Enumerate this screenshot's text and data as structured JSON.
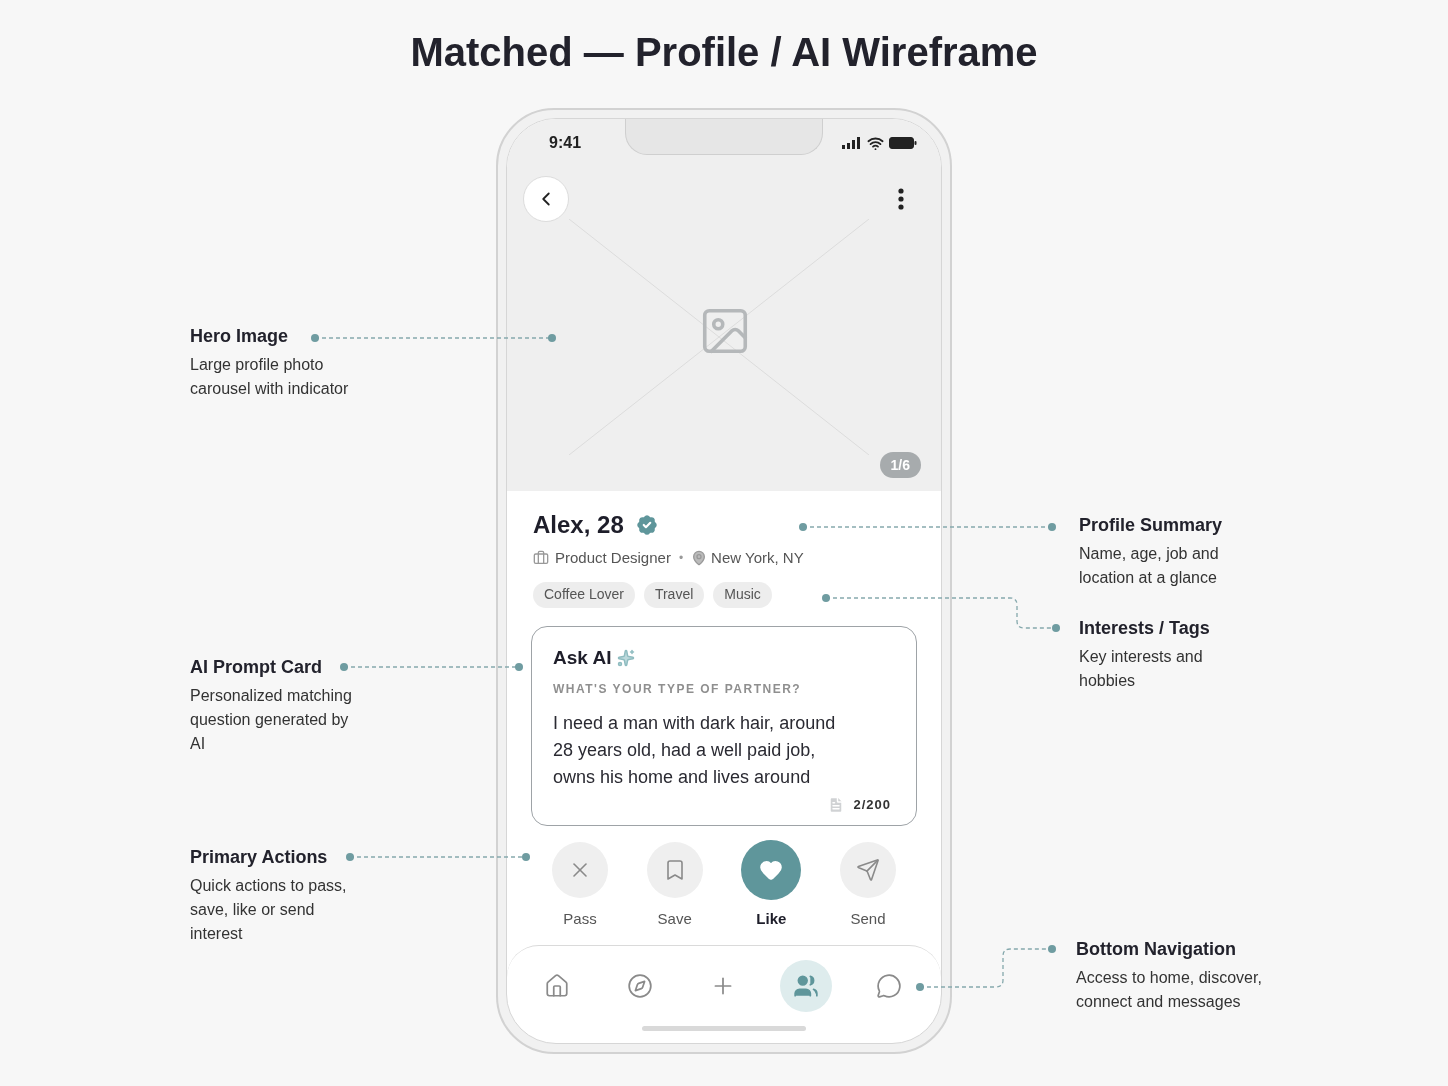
{
  "title": "Matched — Profile / AI Wireframe",
  "phone": {
    "status_bar": {
      "time": "9:41"
    },
    "hero": {
      "counter": "1/6"
    },
    "profile": {
      "name": "Alex, 28",
      "verified": true,
      "job": "Product Designer",
      "separator": "•",
      "location": "New York, NY",
      "tags": [
        "Coffee Lover",
        "Travel",
        "Music"
      ]
    },
    "ai_card": {
      "title": "Ask AI",
      "question": "WHAT'S YOUR TYPE OF PARTNER?",
      "answer": "I need a man with dark hair, around 28 years old, had a well paid job, owns his home and lives around",
      "counter": "2/200"
    },
    "actions": [
      {
        "kind": "pass",
        "label": "Pass",
        "selected": false
      },
      {
        "kind": "save",
        "label": "Save",
        "selected": false
      },
      {
        "kind": "like",
        "label": "Like",
        "selected": true
      },
      {
        "kind": "send",
        "label": "Send",
        "selected": false
      }
    ],
    "nav": [
      {
        "kind": "home",
        "selected": false
      },
      {
        "kind": "discover",
        "selected": false
      },
      {
        "kind": "add",
        "selected": false
      },
      {
        "kind": "connect",
        "selected": true
      },
      {
        "kind": "messages",
        "selected": false
      }
    ]
  },
  "annotations": [
    {
      "title": "Hero Image",
      "description": "Large profile photo carousel with indicator"
    },
    {
      "title": "Profile Summary",
      "description": "Name, age, job and location at a glance"
    },
    {
      "title": "Interests / Tags",
      "description": "Key interests and hobbies"
    },
    {
      "title": "AI Prompt Card",
      "description": "Personalized matching question generated by AI"
    },
    {
      "title": "Primary Actions",
      "description": "Quick actions to pass, save, like or send interest"
    },
    {
      "title": "Bottom Navigation",
      "description": "Access to home, discover, connect and messages"
    }
  ]
}
